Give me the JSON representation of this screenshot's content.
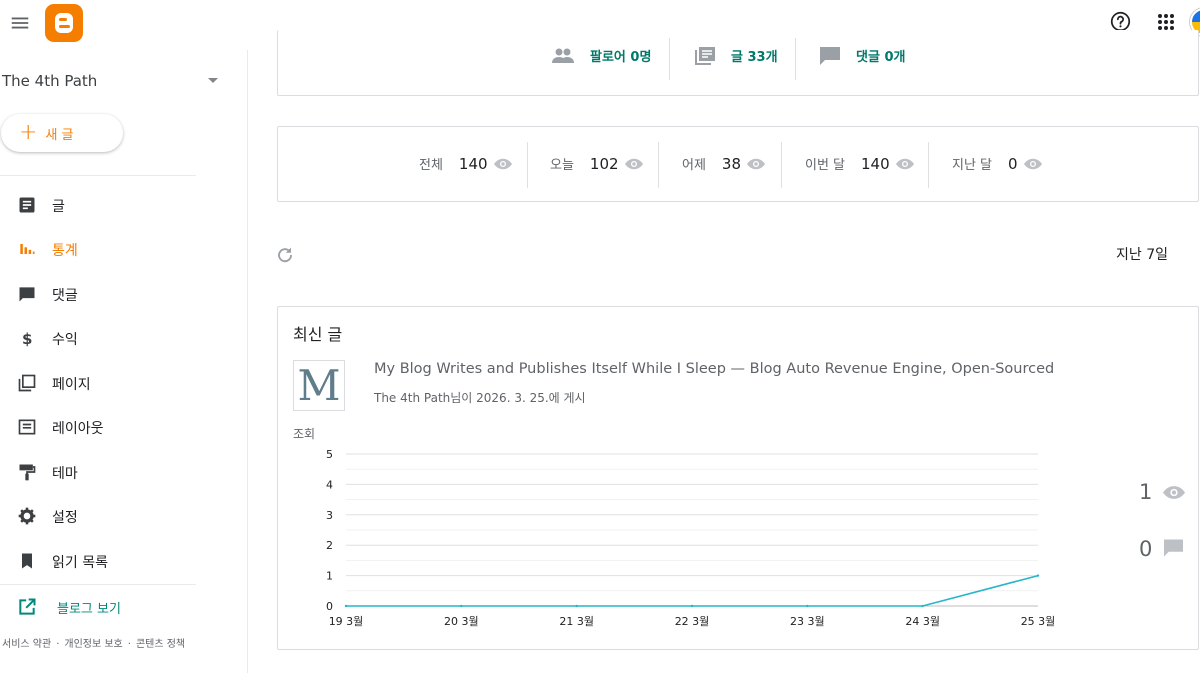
{
  "header": {
    "menu_icon": "menu-icon",
    "logo_icon": "blogger-logo-icon",
    "help_icon": "help-icon",
    "apps_icon": "apps-grid-icon"
  },
  "sidebar": {
    "blog_title": "The 4th Path",
    "new_post_plus": "+",
    "new_post_label": "새 글",
    "items": [
      {
        "label": "글",
        "icon": "posts-icon"
      },
      {
        "label": "통계",
        "icon": "stats-icon"
      },
      {
        "label": "댓글",
        "icon": "comment-icon"
      },
      {
        "label": "수익",
        "icon": "dollar-icon"
      },
      {
        "label": "페이지",
        "icon": "pages-icon"
      },
      {
        "label": "레이아웃",
        "icon": "layout-icon"
      },
      {
        "label": "테마",
        "icon": "theme-icon"
      },
      {
        "label": "설정",
        "icon": "gear-icon"
      },
      {
        "label": "읽기 목록",
        "icon": "bookmark-icon"
      }
    ],
    "view_blog": "블로그 보기",
    "footer": {
      "terms": "서비스 약관",
      "privacy": "개인정보 보호",
      "content_policy": "콘텐츠 정책",
      "dot": "·"
    }
  },
  "summary": {
    "followers": "팔로어 0명",
    "posts": "글 33개",
    "comments": "댓글 0개"
  },
  "views": [
    {
      "label": "전체",
      "value": "140"
    },
    {
      "label": "오늘",
      "value": "102"
    },
    {
      "label": "어제",
      "value": "38"
    },
    {
      "label": "이번 달",
      "value": "140"
    },
    {
      "label": "지난 달",
      "value": "0"
    }
  ],
  "period": "지난 7일",
  "recent": {
    "title": "최신 글",
    "thumb_letter": "M",
    "post_title": "My Blog Writes and Publishes Itself While I Sleep — Blog Auto Revenue Engine, Open-Sourced",
    "post_meta": "The 4th Path님이 2026. 3. 25.에 게시",
    "views_count": "1",
    "comments_count": "0"
  },
  "colors": {
    "accent": "#f57d00",
    "teal": "#00796b",
    "line": "#26b5c9"
  },
  "chart_data": {
    "type": "line",
    "ylabel": "조회",
    "categories": [
      "19 3월",
      "20 3월",
      "21 3월",
      "22 3월",
      "23 3월",
      "24 3월",
      "25 3월"
    ],
    "series": [
      {
        "values": [
          0,
          0,
          0,
          0,
          0,
          0,
          1
        ]
      }
    ],
    "yticks": [
      0,
      1,
      2,
      3,
      4,
      5
    ],
    "ylim": [
      0,
      5
    ],
    "grid": true
  }
}
